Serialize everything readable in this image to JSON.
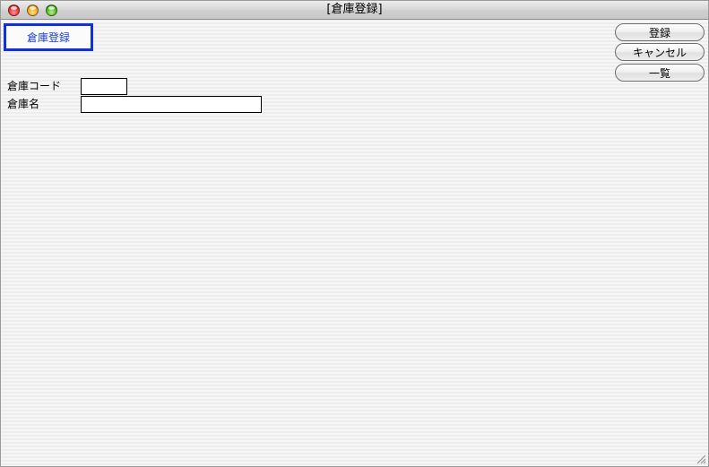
{
  "window": {
    "title": "[倉庫登録]"
  },
  "form": {
    "title": "倉庫登録",
    "title_color": "#1030d8"
  },
  "buttons": {
    "register": "登録",
    "cancel": "キャンセル",
    "list": "一覧"
  },
  "fields": {
    "warehouse_code_label": "倉庫コード",
    "warehouse_code_value": "",
    "warehouse_name_label": "倉庫名",
    "warehouse_name_value": ""
  },
  "icons": {
    "close": "close-icon",
    "minimize": "minimize-icon",
    "maximize": "zoom-icon",
    "resize": "resize-grip-icon"
  }
}
